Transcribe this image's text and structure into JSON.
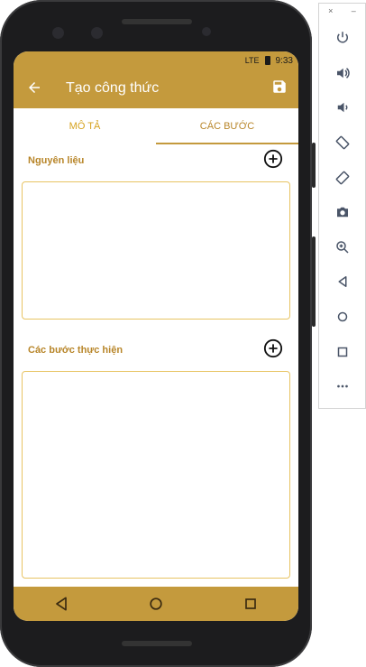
{
  "status": {
    "time": "9:33",
    "network": "LTE"
  },
  "appbar": {
    "title": "Tạo công thức"
  },
  "tabs": [
    {
      "label": "MÔ TẢ",
      "active": false
    },
    {
      "label": "CÁC BƯỚC",
      "active": true
    }
  ],
  "sections": {
    "ingredients": {
      "label": "Nguyên liệu"
    },
    "steps": {
      "label": "Các bước thực hiện"
    }
  },
  "colors": {
    "accent": "#c49a3d",
    "accent_text": "#b8862a",
    "border": "#e8c463"
  },
  "emulator_panel": {
    "close": "×",
    "minimize": "–",
    "icons": [
      "power-icon",
      "volume-up-icon",
      "volume-down-icon",
      "rotate-left-icon",
      "rotate-right-icon",
      "camera-icon",
      "zoom-icon",
      "back-icon",
      "home-icon",
      "overview-icon",
      "more-icon"
    ]
  }
}
